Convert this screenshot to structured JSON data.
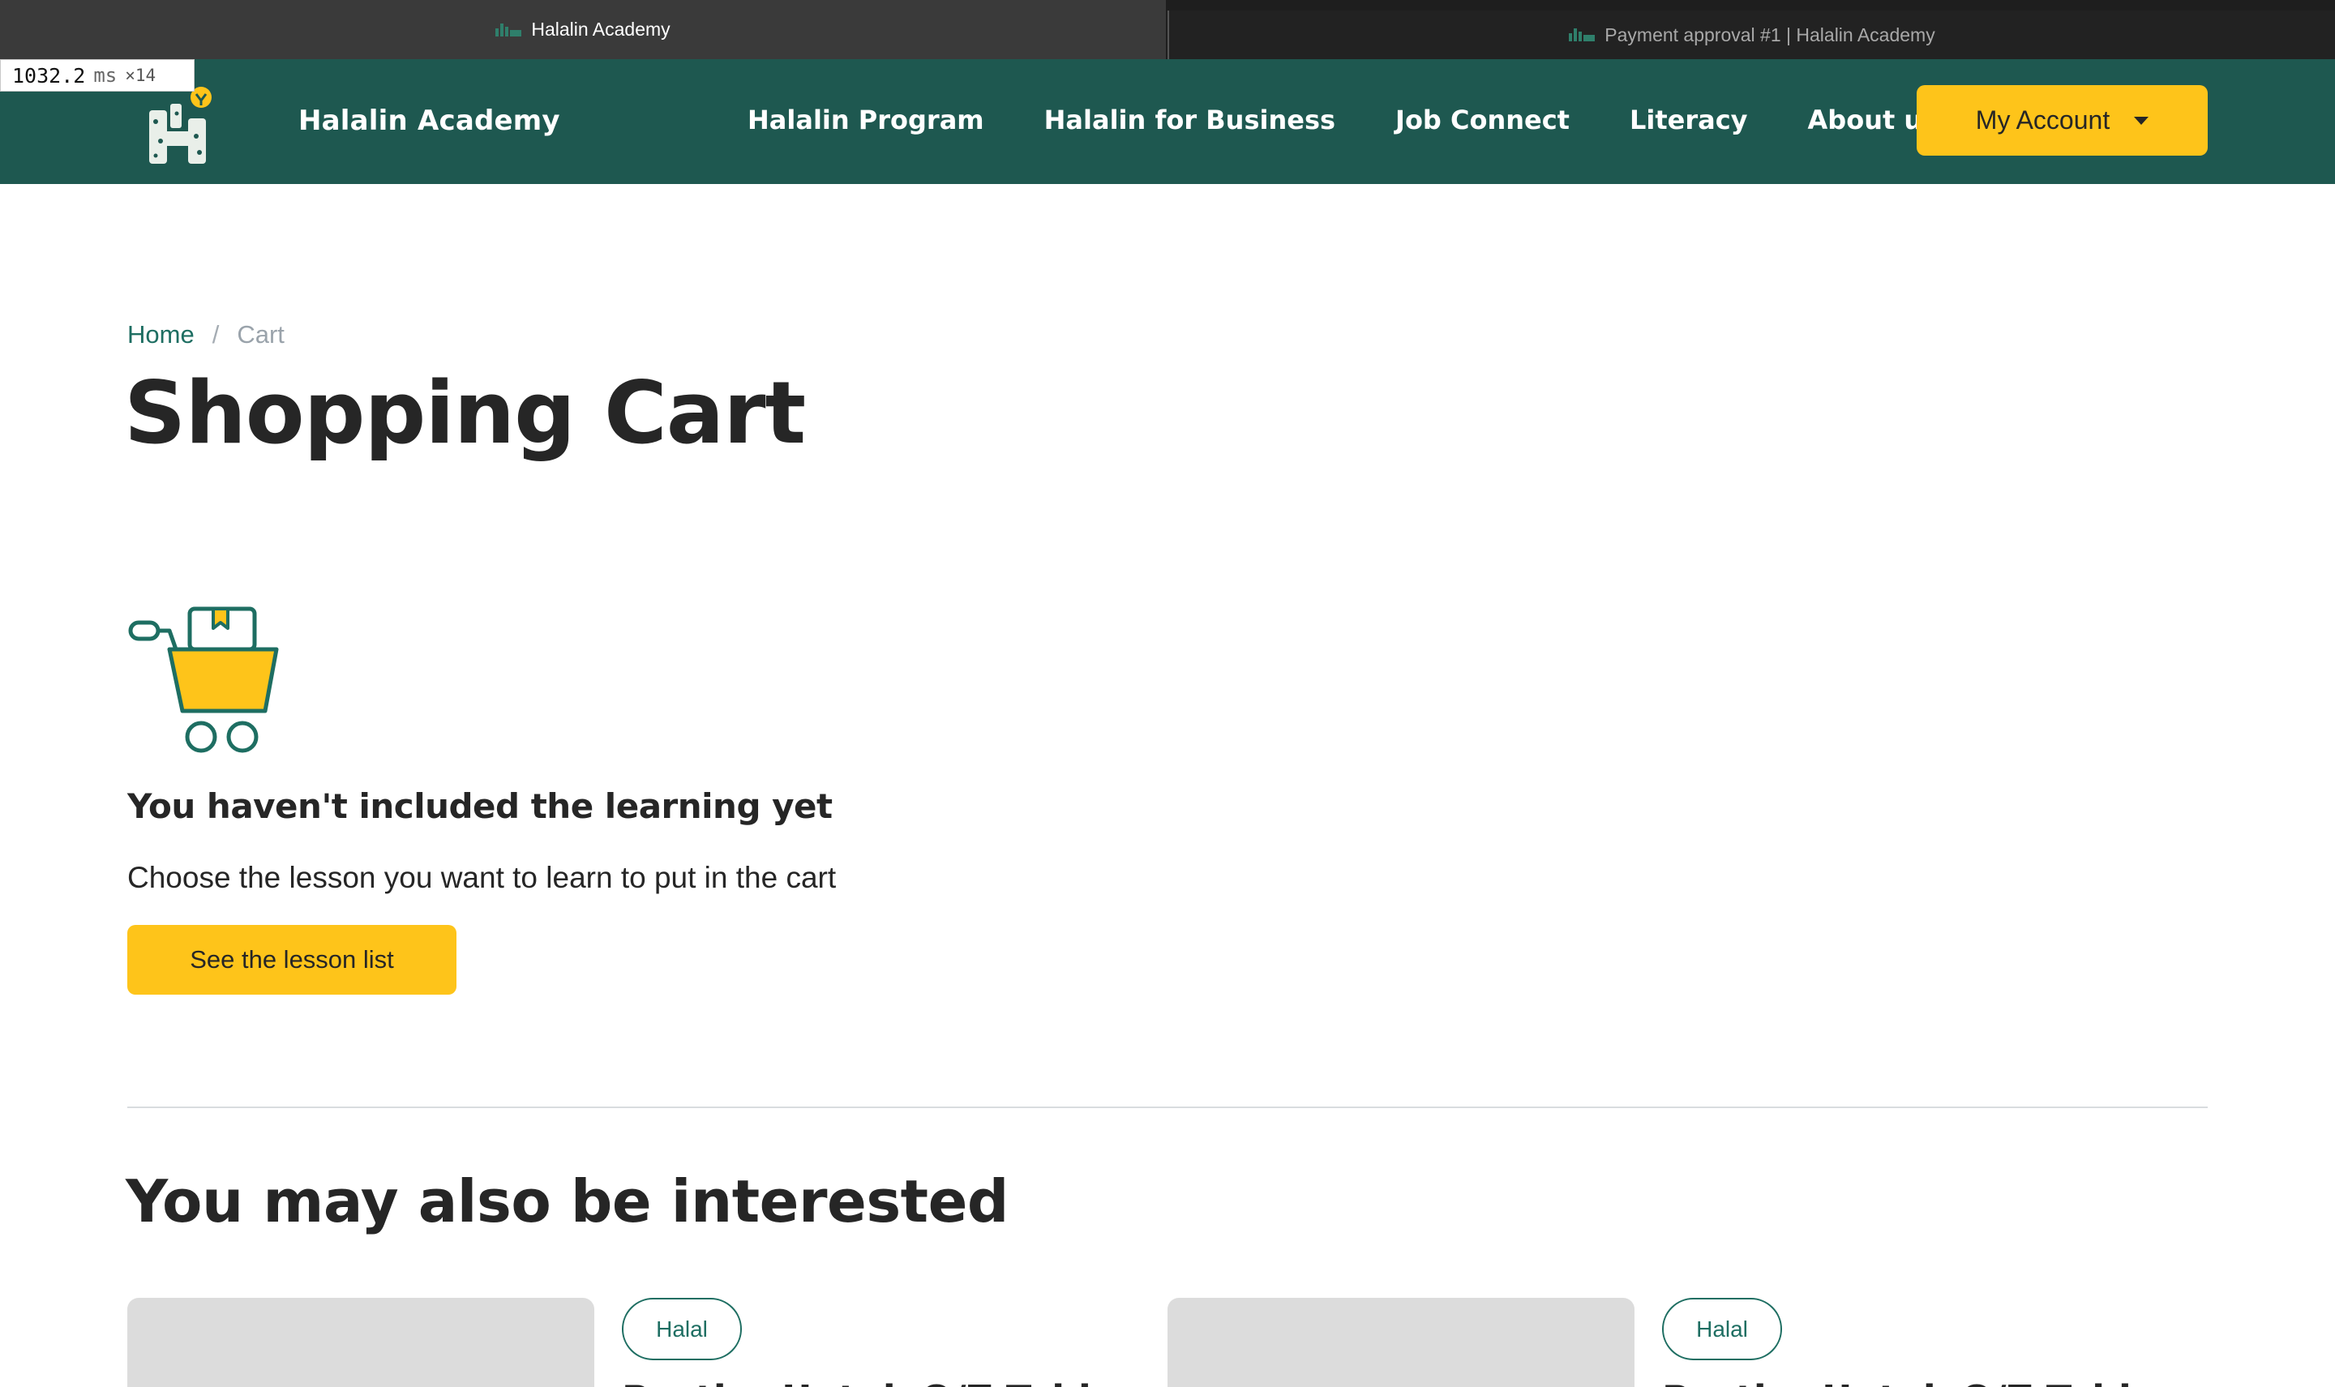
{
  "browser": {
    "tabs": [
      {
        "title": "Halalin Academy",
        "active": true
      },
      {
        "title": "Payment approval #1 | Halalin Academy",
        "active": false
      }
    ]
  },
  "perf_overlay": {
    "value": "1032.2",
    "unit": "ms",
    "multiplier": "×14"
  },
  "nav": {
    "brand": "Halalin Academy",
    "items": [
      "Halalin Program",
      "Halalin for Business",
      "Job Connect",
      "Literacy",
      "About us"
    ],
    "account_label": "My Account"
  },
  "breadcrumb": {
    "home": "Home",
    "separator": "/",
    "current": "Cart"
  },
  "page_title": "Shopping Cart",
  "empty_state": {
    "heading": "You haven't included the learning yet",
    "subtext": "Choose the lesson you want to learn to put in the cart",
    "button_label": "See the lesson list"
  },
  "recommendations": {
    "title": "You may also be interested",
    "cards": [
      {
        "tag": "Halal",
        "title": "Pasti... Untuk Q/Z Tahl..."
      },
      {
        "tag": "Halal",
        "title": "Pasti... Untuk Q/Z Tahl..."
      }
    ]
  },
  "colors": {
    "brand_green": "#1e5850",
    "accent_yellow": "#fec41a",
    "link_green": "#1e6e62"
  }
}
